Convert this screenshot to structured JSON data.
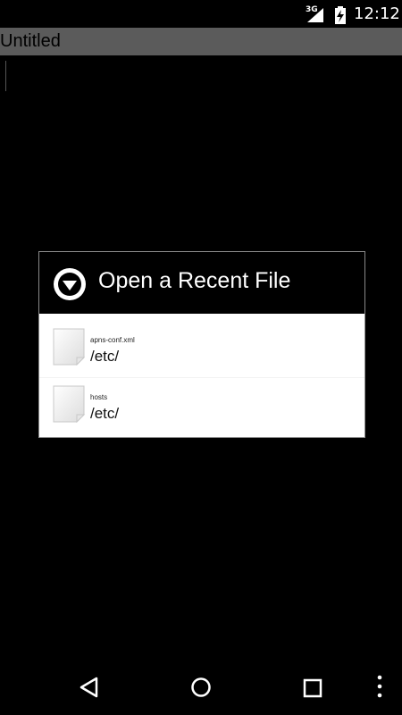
{
  "status_bar": {
    "network": "3G",
    "time": "12:12",
    "icons": [
      "signal-icon",
      "battery-icon"
    ]
  },
  "app": {
    "title": "Untitled"
  },
  "dialog": {
    "title": "Open a Recent File",
    "header_icon": "chevron-down-circle-icon",
    "files": [
      {
        "name": "apns-conf.xml",
        "path": "/etc/",
        "icon": "file-icon"
      },
      {
        "name": "hosts",
        "path": "/etc/",
        "icon": "file-icon"
      }
    ]
  },
  "nav_bar": {
    "icons": [
      "back-icon",
      "home-icon",
      "recents-icon",
      "overflow-menu-icon"
    ]
  }
}
